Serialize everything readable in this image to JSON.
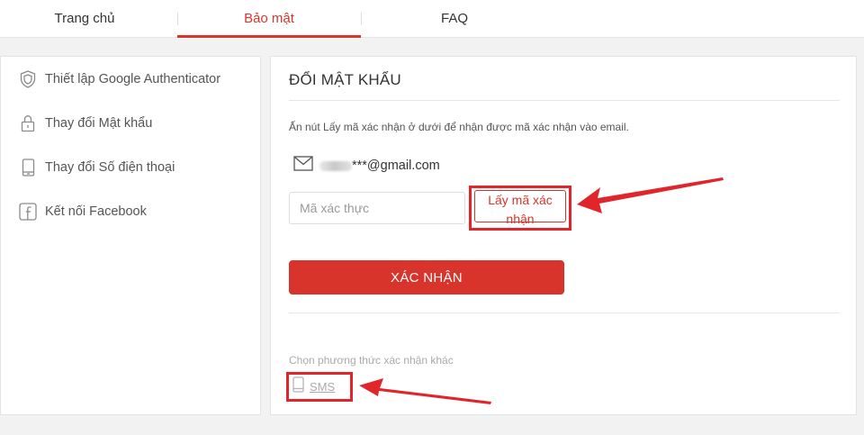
{
  "nav": {
    "tabs": [
      {
        "label": "Trang chủ"
      },
      {
        "label": "Bảo mật"
      },
      {
        "label": "FAQ"
      }
    ],
    "active_tab": "Bảo mật"
  },
  "sidebar": {
    "items": [
      {
        "label": "Thiết lập Google Authenticator",
        "icon": "shield-icon"
      },
      {
        "label": "Thay đổi Mật khẩu",
        "icon": "lock-icon"
      },
      {
        "label": "Thay đổi Số điện thoại",
        "icon": "phone-icon"
      },
      {
        "label": "Kết nối Facebook",
        "icon": "facebook-icon"
      }
    ]
  },
  "panel": {
    "title": "ĐỔI MẬT KHẨU",
    "instruction": "Ấn nút Lấy mã xác nhận ở dưới để nhận được mã xác nhận vào email.",
    "email": "***@gmail.com",
    "code_input": {
      "placeholder": "Mã xác thực",
      "value": ""
    },
    "get_code_label": "Lấy mã xác nhận",
    "confirm_label": "XÁC NHẬN",
    "alt_method_label": "Chọn phương thức xác nhận khác",
    "sms_label": "SMS"
  },
  "colors": {
    "accent": "#d9342b",
    "annotation": "#e0262b",
    "background": "#f2f2f2"
  }
}
